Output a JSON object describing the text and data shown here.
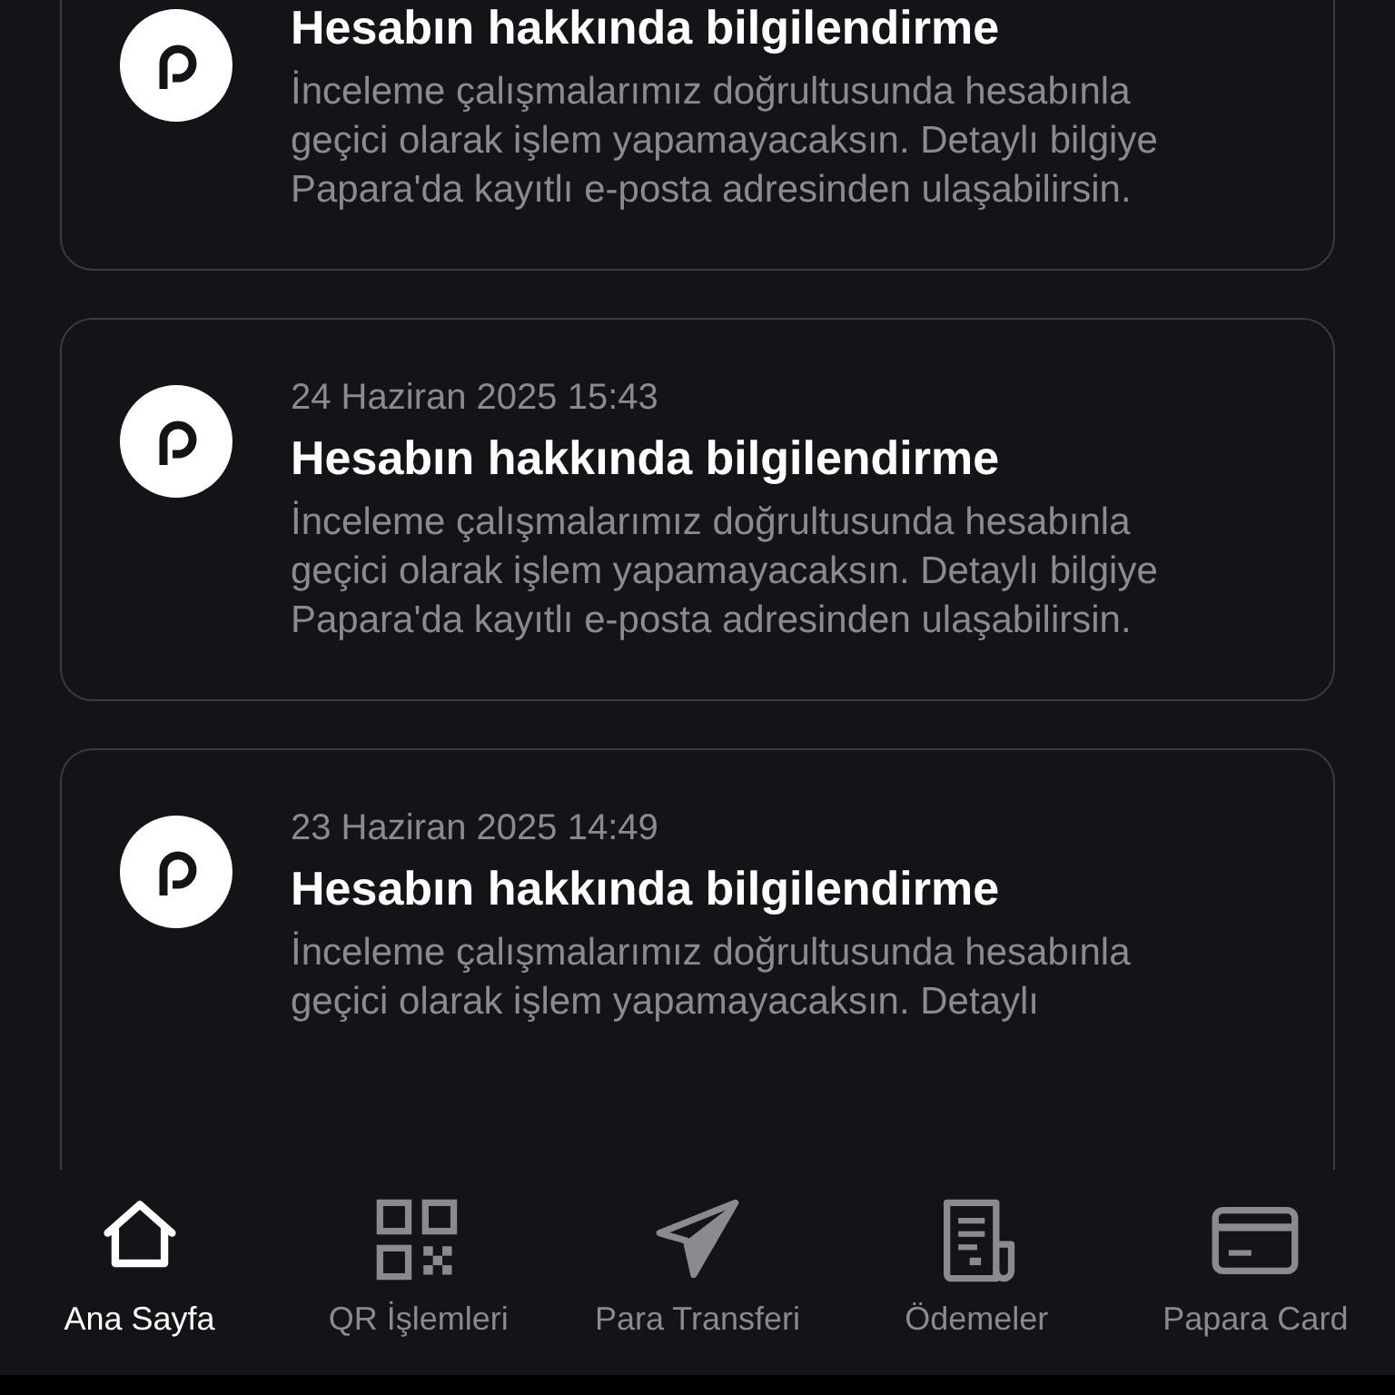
{
  "notifications": [
    {
      "title": "Hesabın hakkında bilgilendirme",
      "message": "İnceleme çalışmalarımız doğrultusunda hesabınla geçici olarak işlem yapamayacaksın. Detaylı bilgiye Papara'da kayıtlı e-posta adresinden ulaşabilirsin."
    },
    {
      "date": "24 Haziran 2025 15:43",
      "title": "Hesabın hakkında bilgilendirme",
      "message": "İnceleme çalışmalarımız doğrultusunda hesabınla geçici olarak işlem yapamayacaksın. Detaylı bilgiye Papara'da kayıtlı e-posta adresinden ulaşabilirsin."
    },
    {
      "date": "23 Haziran 2025 14:49",
      "title": "Hesabın hakkında bilgilendirme",
      "message": "İnceleme çalışmalarımız doğrultusunda hesabınla geçici olarak işlem yapamayacaksın. Detaylı"
    }
  ],
  "bottom_nav": [
    {
      "kind": "home",
      "label": "Ana Sayfa",
      "selected": true
    },
    {
      "kind": "qr",
      "label": "QR İşlemleri",
      "selected": false
    },
    {
      "kind": "send",
      "label": "Para Transferi",
      "selected": false
    },
    {
      "kind": "bill",
      "label": "Ödemeler",
      "selected": false
    },
    {
      "kind": "card",
      "label": "Papara Card",
      "selected": false
    }
  ]
}
